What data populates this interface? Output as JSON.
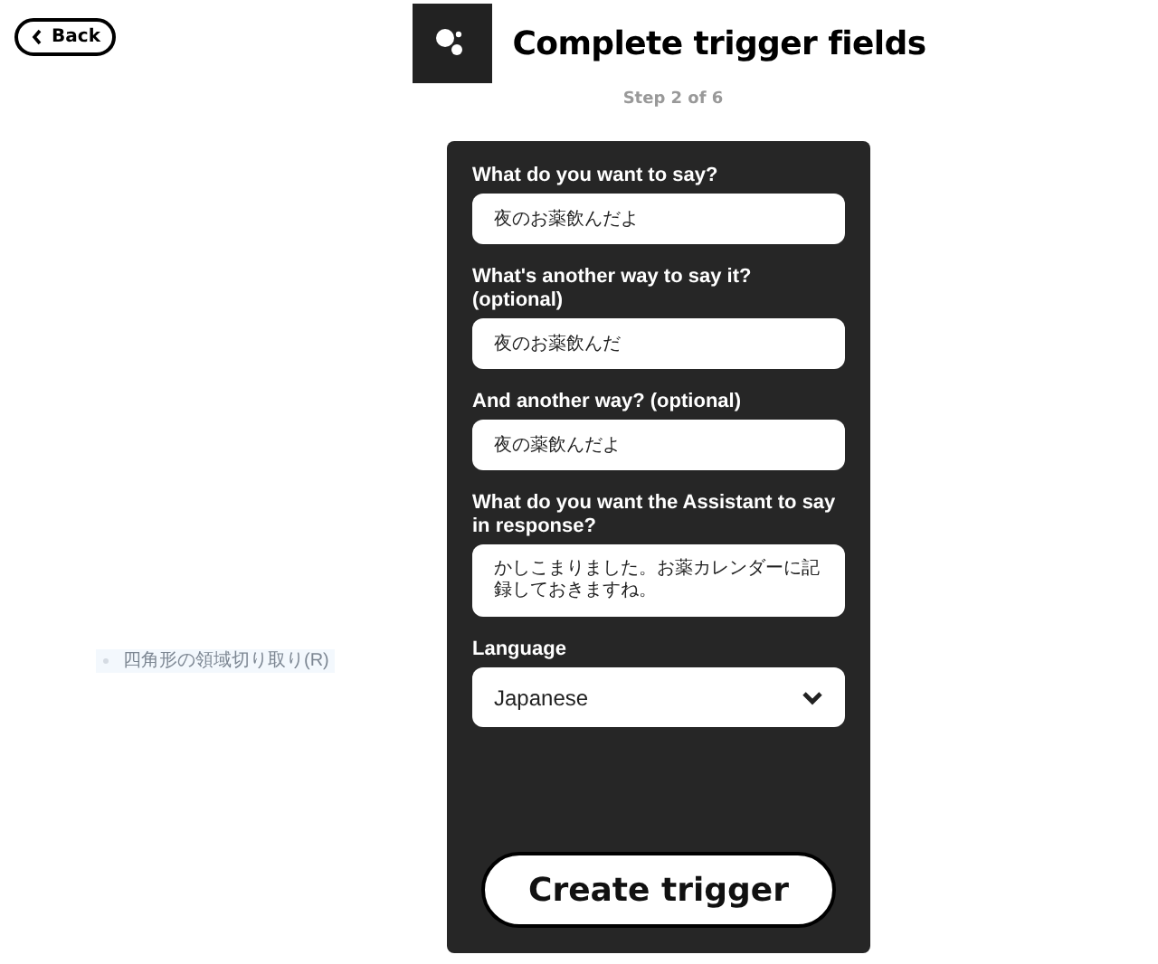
{
  "back_button": {
    "label": "Back"
  },
  "header": {
    "title": "Complete trigger fields",
    "step": "Step 2 of 6"
  },
  "form": {
    "fields": [
      {
        "kind": "text",
        "label": "What do you want to say?",
        "value": "夜のお薬飲んだよ"
      },
      {
        "kind": "text",
        "label": "What's another way to say it? (optional)",
        "value": "夜のお薬飲んだ"
      },
      {
        "kind": "text",
        "label": "And another way? (optional)",
        "value": "夜の薬飲んだよ"
      },
      {
        "kind": "textarea",
        "label": "What do you want the Assistant to say in response?",
        "value": "かしこまりました。お薬カレンダーに記録しておきますね。"
      },
      {
        "kind": "select",
        "label": "Language",
        "value": "Japanese"
      }
    ],
    "submit": "Create trigger"
  },
  "overlay_tooltip": {
    "text": "四角形の領域切り取り(R)"
  }
}
